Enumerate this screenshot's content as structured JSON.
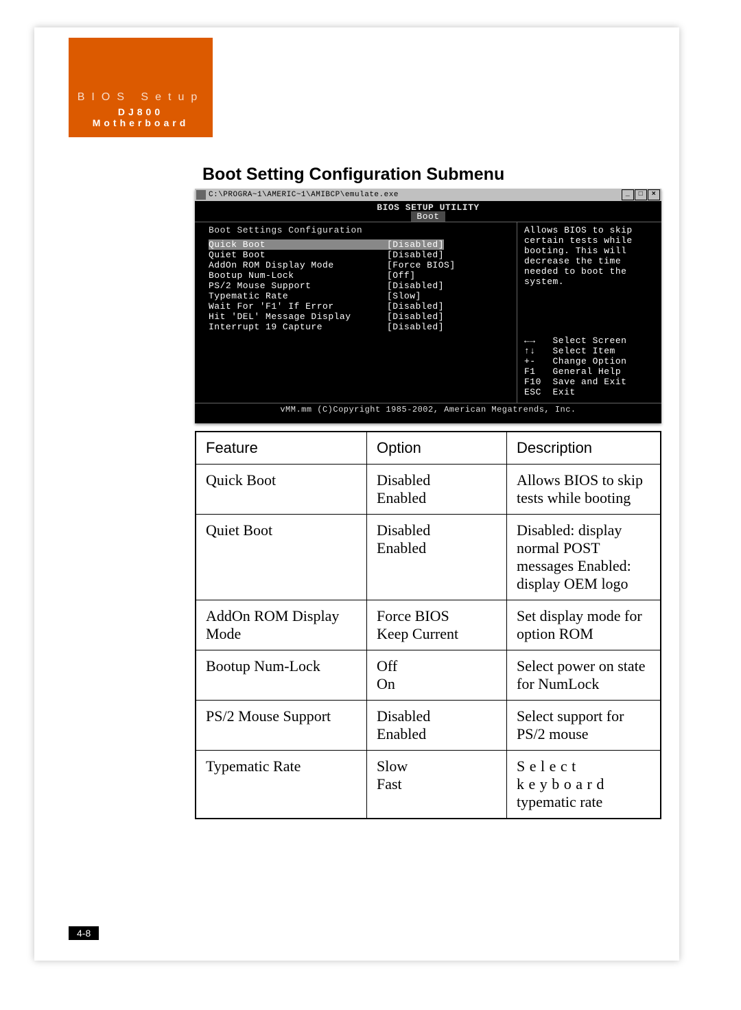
{
  "header": {
    "bios_label": "BIOS Setup",
    "model": "DJ800 Motherboard"
  },
  "section_title": "Boot Setting Configuration Submenu",
  "page_number": "4-8",
  "bios_window": {
    "titlebar_path": "C:\\PROGRA~1\\AMERIC~1\\AMIBCP\\emulate.exe",
    "utility_title": "BIOS SETUP UTILITY",
    "active_tab": "Boot",
    "left_heading": "Boot Settings Configuration",
    "items": [
      {
        "label": "Quick Boot",
        "value": "[Disabled]",
        "selected": true
      },
      {
        "label": "Quiet Boot",
        "value": "[Disabled]"
      },
      {
        "label": "AddOn ROM Display Mode",
        "value": "[Force BIOS]"
      },
      {
        "label": "Bootup Num-Lock",
        "value": "[Off]"
      },
      {
        "label": "PS/2 Mouse Support",
        "value": "[Disabled]"
      },
      {
        "label": "Typematic Rate",
        "value": "[Slow]"
      },
      {
        "label": "Wait For 'F1' If Error",
        "value": "[Disabled]"
      },
      {
        "label": "Hit 'DEL' Message Display",
        "value": "[Disabled]"
      },
      {
        "label": "Interrupt 19 Capture",
        "value": "[Disabled]"
      }
    ],
    "help_text": "Allows BIOS to skip certain tests while booting. This will decrease the time needed to boot the system.",
    "key_legend": "←→   Select Screen\n↑↓   Select Item\n+-   Change Option\nF1   General Help\nF10  Save and Exit\nESC  Exit",
    "footer": "vMM.mm (C)Copyright 1985-2002, American Megatrends, Inc."
  },
  "feature_table": {
    "headers": {
      "col1": "Feature",
      "col2": "Option",
      "col3": "Description"
    },
    "rows": [
      {
        "feature": "Quick Boot",
        "option": "Disabled\nEnabled",
        "description": "Allows BIOS to skip tests while booting"
      },
      {
        "feature": "Quiet Boot",
        "option": "Disabled\nEnabled",
        "description": "Disabled: display normal POST messages Enabled: display OEM logo"
      },
      {
        "feature": "AddOn ROM Display Mode",
        "option": "Force BIOS\nKeep Current",
        "description": "Set display mode for option ROM"
      },
      {
        "feature": "Bootup Num-Lock",
        "option": "Off\nOn",
        "description": "Select power on state for NumLock"
      },
      {
        "feature": "PS/2 Mouse Support",
        "option": "Disabled\nEnabled",
        "description": "Select support for PS/2 mouse"
      },
      {
        "feature": "Typematic Rate",
        "option": "Slow\nFast",
        "description": "Select keyboard",
        "description2": "typematic rate"
      }
    ]
  }
}
